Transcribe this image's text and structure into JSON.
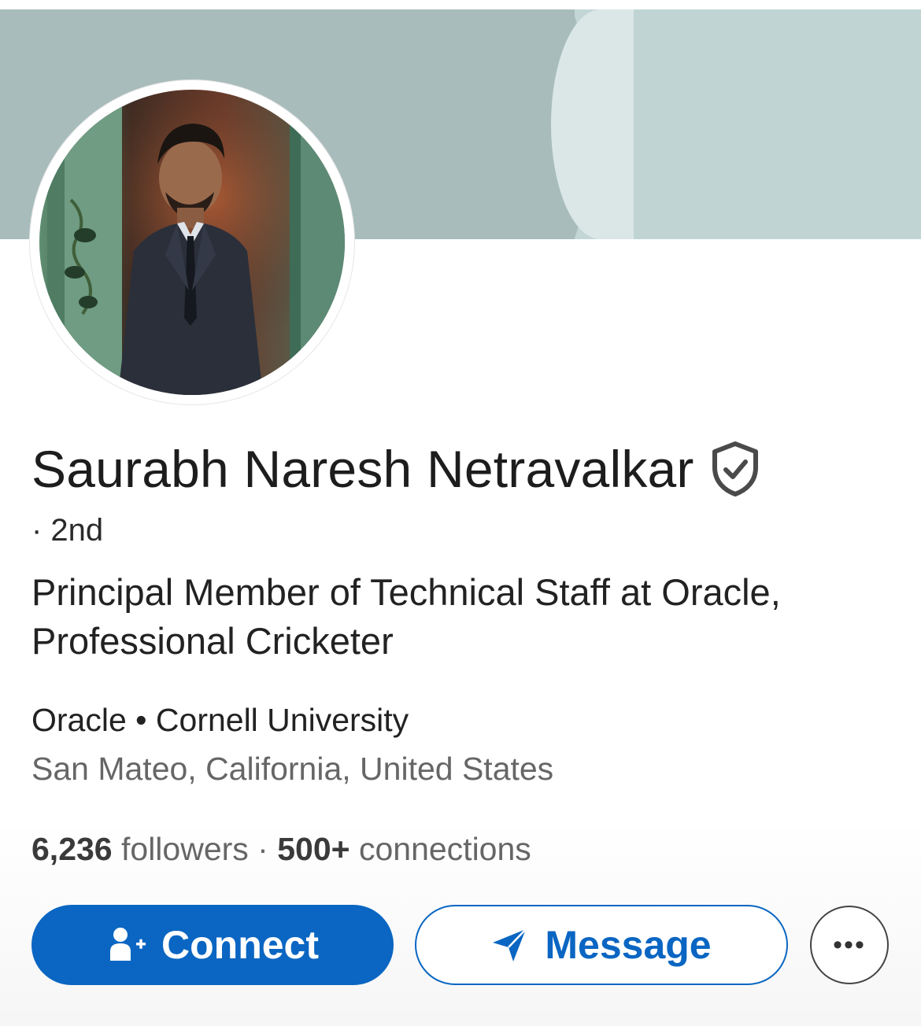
{
  "profile": {
    "name": "Saurabh Naresh Netravalkar",
    "degree": "· 2nd",
    "headline": "Principal Member of Technical Staff at Oracle, Professional Cricketer",
    "company": "Oracle",
    "school": "Cornell University",
    "separator": " • ",
    "location": "San Mateo, California, United States",
    "followers_count": "6,236",
    "followers_label": " followers",
    "stats_separator": " · ",
    "connections_count": "500+",
    "connections_label": " connections"
  },
  "actions": {
    "connect_label": "Connect",
    "message_label": "Message",
    "more_label": "•••"
  },
  "icons": {
    "verified": "verified-shield-icon",
    "connect": "add-person-icon",
    "message": "send-icon",
    "more": "more-options-icon"
  },
  "colors": {
    "brand_blue": "#0a66c2",
    "banner_dark": "#a9bcbc",
    "banner_light": "#c0d4d4",
    "text_primary": "#1d1d1d",
    "text_secondary": "#666666"
  }
}
